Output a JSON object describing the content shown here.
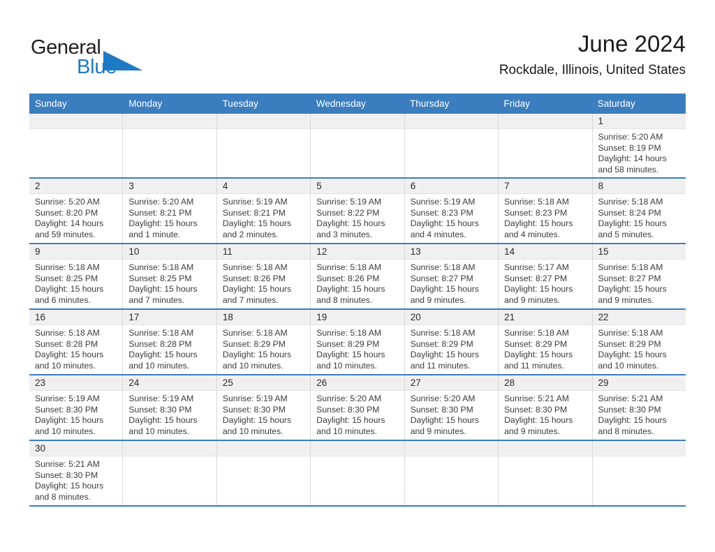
{
  "brand": {
    "name_part1": "General",
    "name_part2": "Blue",
    "accent_color": "#1f7ac4",
    "header_color": "#3a7ebf"
  },
  "header": {
    "month_title": "June 2024",
    "location": "Rockdale, Illinois, United States"
  },
  "calendar": {
    "weekdays": [
      "Sunday",
      "Monday",
      "Tuesday",
      "Wednesday",
      "Thursday",
      "Friday",
      "Saturday"
    ],
    "weeks": [
      [
        null,
        null,
        null,
        null,
        null,
        null,
        {
          "day": "1",
          "sunrise": "Sunrise: 5:20 AM",
          "sunset": "Sunset: 8:19 PM",
          "daylight_line1": "Daylight: 14 hours",
          "daylight_line2": "and 58 minutes."
        }
      ],
      [
        {
          "day": "2",
          "sunrise": "Sunrise: 5:20 AM",
          "sunset": "Sunset: 8:20 PM",
          "daylight_line1": "Daylight: 14 hours",
          "daylight_line2": "and 59 minutes."
        },
        {
          "day": "3",
          "sunrise": "Sunrise: 5:20 AM",
          "sunset": "Sunset: 8:21 PM",
          "daylight_line1": "Daylight: 15 hours",
          "daylight_line2": "and 1 minute."
        },
        {
          "day": "4",
          "sunrise": "Sunrise: 5:19 AM",
          "sunset": "Sunset: 8:21 PM",
          "daylight_line1": "Daylight: 15 hours",
          "daylight_line2": "and 2 minutes."
        },
        {
          "day": "5",
          "sunrise": "Sunrise: 5:19 AM",
          "sunset": "Sunset: 8:22 PM",
          "daylight_line1": "Daylight: 15 hours",
          "daylight_line2": "and 3 minutes."
        },
        {
          "day": "6",
          "sunrise": "Sunrise: 5:19 AM",
          "sunset": "Sunset: 8:23 PM",
          "daylight_line1": "Daylight: 15 hours",
          "daylight_line2": "and 4 minutes."
        },
        {
          "day": "7",
          "sunrise": "Sunrise: 5:18 AM",
          "sunset": "Sunset: 8:23 PM",
          "daylight_line1": "Daylight: 15 hours",
          "daylight_line2": "and 4 minutes."
        },
        {
          "day": "8",
          "sunrise": "Sunrise: 5:18 AM",
          "sunset": "Sunset: 8:24 PM",
          "daylight_line1": "Daylight: 15 hours",
          "daylight_line2": "and 5 minutes."
        }
      ],
      [
        {
          "day": "9",
          "sunrise": "Sunrise: 5:18 AM",
          "sunset": "Sunset: 8:25 PM",
          "daylight_line1": "Daylight: 15 hours",
          "daylight_line2": "and 6 minutes."
        },
        {
          "day": "10",
          "sunrise": "Sunrise: 5:18 AM",
          "sunset": "Sunset: 8:25 PM",
          "daylight_line1": "Daylight: 15 hours",
          "daylight_line2": "and 7 minutes."
        },
        {
          "day": "11",
          "sunrise": "Sunrise: 5:18 AM",
          "sunset": "Sunset: 8:26 PM",
          "daylight_line1": "Daylight: 15 hours",
          "daylight_line2": "and 7 minutes."
        },
        {
          "day": "12",
          "sunrise": "Sunrise: 5:18 AM",
          "sunset": "Sunset: 8:26 PM",
          "daylight_line1": "Daylight: 15 hours",
          "daylight_line2": "and 8 minutes."
        },
        {
          "day": "13",
          "sunrise": "Sunrise: 5:18 AM",
          "sunset": "Sunset: 8:27 PM",
          "daylight_line1": "Daylight: 15 hours",
          "daylight_line2": "and 9 minutes."
        },
        {
          "day": "14",
          "sunrise": "Sunrise: 5:17 AM",
          "sunset": "Sunset: 8:27 PM",
          "daylight_line1": "Daylight: 15 hours",
          "daylight_line2": "and 9 minutes."
        },
        {
          "day": "15",
          "sunrise": "Sunrise: 5:18 AM",
          "sunset": "Sunset: 8:27 PM",
          "daylight_line1": "Daylight: 15 hours",
          "daylight_line2": "and 9 minutes."
        }
      ],
      [
        {
          "day": "16",
          "sunrise": "Sunrise: 5:18 AM",
          "sunset": "Sunset: 8:28 PM",
          "daylight_line1": "Daylight: 15 hours",
          "daylight_line2": "and 10 minutes."
        },
        {
          "day": "17",
          "sunrise": "Sunrise: 5:18 AM",
          "sunset": "Sunset: 8:28 PM",
          "daylight_line1": "Daylight: 15 hours",
          "daylight_line2": "and 10 minutes."
        },
        {
          "day": "18",
          "sunrise": "Sunrise: 5:18 AM",
          "sunset": "Sunset: 8:29 PM",
          "daylight_line1": "Daylight: 15 hours",
          "daylight_line2": "and 10 minutes."
        },
        {
          "day": "19",
          "sunrise": "Sunrise: 5:18 AM",
          "sunset": "Sunset: 8:29 PM",
          "daylight_line1": "Daylight: 15 hours",
          "daylight_line2": "and 10 minutes."
        },
        {
          "day": "20",
          "sunrise": "Sunrise: 5:18 AM",
          "sunset": "Sunset: 8:29 PM",
          "daylight_line1": "Daylight: 15 hours",
          "daylight_line2": "and 11 minutes."
        },
        {
          "day": "21",
          "sunrise": "Sunrise: 5:18 AM",
          "sunset": "Sunset: 8:29 PM",
          "daylight_line1": "Daylight: 15 hours",
          "daylight_line2": "and 11 minutes."
        },
        {
          "day": "22",
          "sunrise": "Sunrise: 5:18 AM",
          "sunset": "Sunset: 8:29 PM",
          "daylight_line1": "Daylight: 15 hours",
          "daylight_line2": "and 10 minutes."
        }
      ],
      [
        {
          "day": "23",
          "sunrise": "Sunrise: 5:19 AM",
          "sunset": "Sunset: 8:30 PM",
          "daylight_line1": "Daylight: 15 hours",
          "daylight_line2": "and 10 minutes."
        },
        {
          "day": "24",
          "sunrise": "Sunrise: 5:19 AM",
          "sunset": "Sunset: 8:30 PM",
          "daylight_line1": "Daylight: 15 hours",
          "daylight_line2": "and 10 minutes."
        },
        {
          "day": "25",
          "sunrise": "Sunrise: 5:19 AM",
          "sunset": "Sunset: 8:30 PM",
          "daylight_line1": "Daylight: 15 hours",
          "daylight_line2": "and 10 minutes."
        },
        {
          "day": "26",
          "sunrise": "Sunrise: 5:20 AM",
          "sunset": "Sunset: 8:30 PM",
          "daylight_line1": "Daylight: 15 hours",
          "daylight_line2": "and 10 minutes."
        },
        {
          "day": "27",
          "sunrise": "Sunrise: 5:20 AM",
          "sunset": "Sunset: 8:30 PM",
          "daylight_line1": "Daylight: 15 hours",
          "daylight_line2": "and 9 minutes."
        },
        {
          "day": "28",
          "sunrise": "Sunrise: 5:21 AM",
          "sunset": "Sunset: 8:30 PM",
          "daylight_line1": "Daylight: 15 hours",
          "daylight_line2": "and 9 minutes."
        },
        {
          "day": "29",
          "sunrise": "Sunrise: 5:21 AM",
          "sunset": "Sunset: 8:30 PM",
          "daylight_line1": "Daylight: 15 hours",
          "daylight_line2": "and 8 minutes."
        }
      ],
      [
        {
          "day": "30",
          "sunrise": "Sunrise: 5:21 AM",
          "sunset": "Sunset: 8:30 PM",
          "daylight_line1": "Daylight: 15 hours",
          "daylight_line2": "and 8 minutes."
        },
        null,
        null,
        null,
        null,
        null,
        null
      ]
    ]
  }
}
